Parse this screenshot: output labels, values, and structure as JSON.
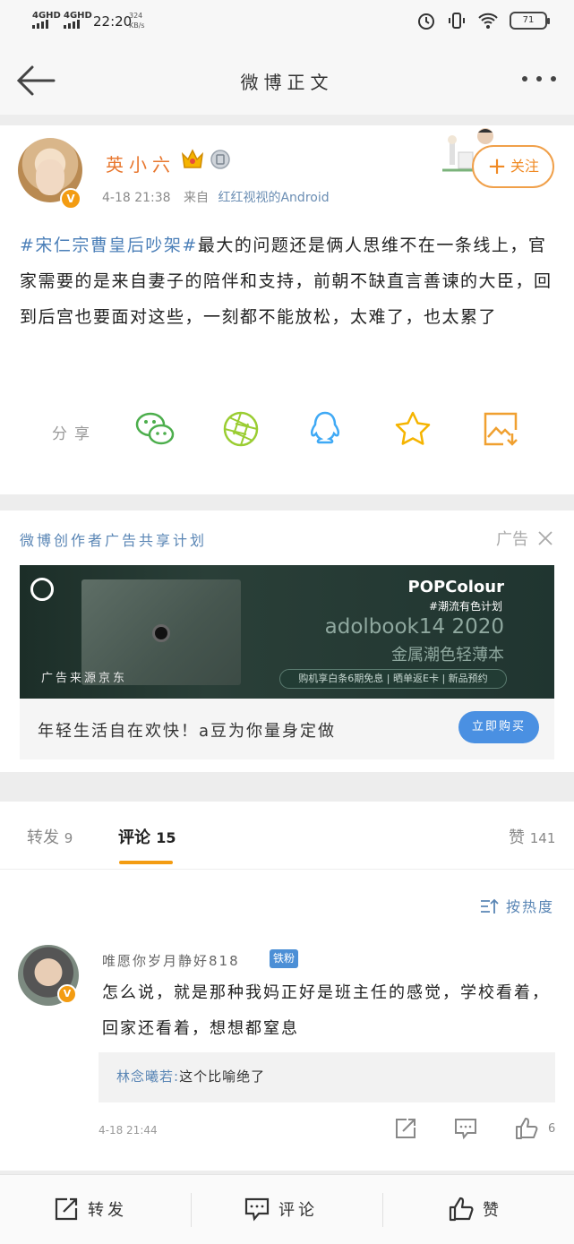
{
  "status_bar": {
    "network_1": "4GHD",
    "network_2": "4GHD",
    "time": "22:20",
    "speed_value": "324",
    "speed_unit": "KB/s",
    "battery": "71"
  },
  "navbar": {
    "title": "微博正文"
  },
  "post": {
    "username": "英小六",
    "time": "4-18 21:38",
    "source_prefix": "来自",
    "source": "红红视视的Android",
    "follow_label": "关注",
    "topic": "#宋仁宗曹皇后吵架#",
    "body": "最大的问题还是俩人思维不在一条线上，官家需要的是来自妻子的陪伴和支持，前朝不缺直言善谏的大臣，回到后宫也要面对这些，一刻都不能放松，太难了，也太累了",
    "share_label": "分享",
    "share_icons": [
      "wechat-icon",
      "moments-icon",
      "qq-icon",
      "favorite-star-icon",
      "save-image-icon"
    ]
  },
  "ad": {
    "title": "微博创作者广告共享计划",
    "label": "广告",
    "banner_brand": "POPColour",
    "banner_tag": "#潮流有色计划",
    "banner_model": "adolbook14 2020",
    "banner_slogan": "金属潮色轻薄本",
    "banner_promo": "购机享白条6期免息 | 晒单返E卡 | 新品预约",
    "banner_source": "广告来源京东",
    "footer_text": "年轻生活自在欢快！a豆为你量身定做",
    "cta": "立即购买",
    "colors": {
      "cta": "#4a90e2"
    }
  },
  "comments": {
    "tabs": [
      {
        "label": "转发",
        "count": "9"
      },
      {
        "label": "评论",
        "count": "15"
      },
      {
        "label": "赞",
        "count": "141"
      }
    ],
    "sort_label": "按热度",
    "items": [
      {
        "username": "唯愿你岁月静好818",
        "badge": "铁粉",
        "text": "怎么说，就是那种我妈正好是班主任的感觉，学校看着，回家还看着，想想都窒息",
        "reply_user": "林念曦若:",
        "reply_text": "这个比喻绝了",
        "time": "4-18 21:44",
        "likes": "6"
      }
    ]
  },
  "bottom_bar": {
    "repost": "转发",
    "comment": "评论",
    "like": "赞"
  },
  "colors": {
    "accent_orange": "#f39c12",
    "link_blue": "#4b7fb8",
    "username_orange": "#e8772e"
  }
}
